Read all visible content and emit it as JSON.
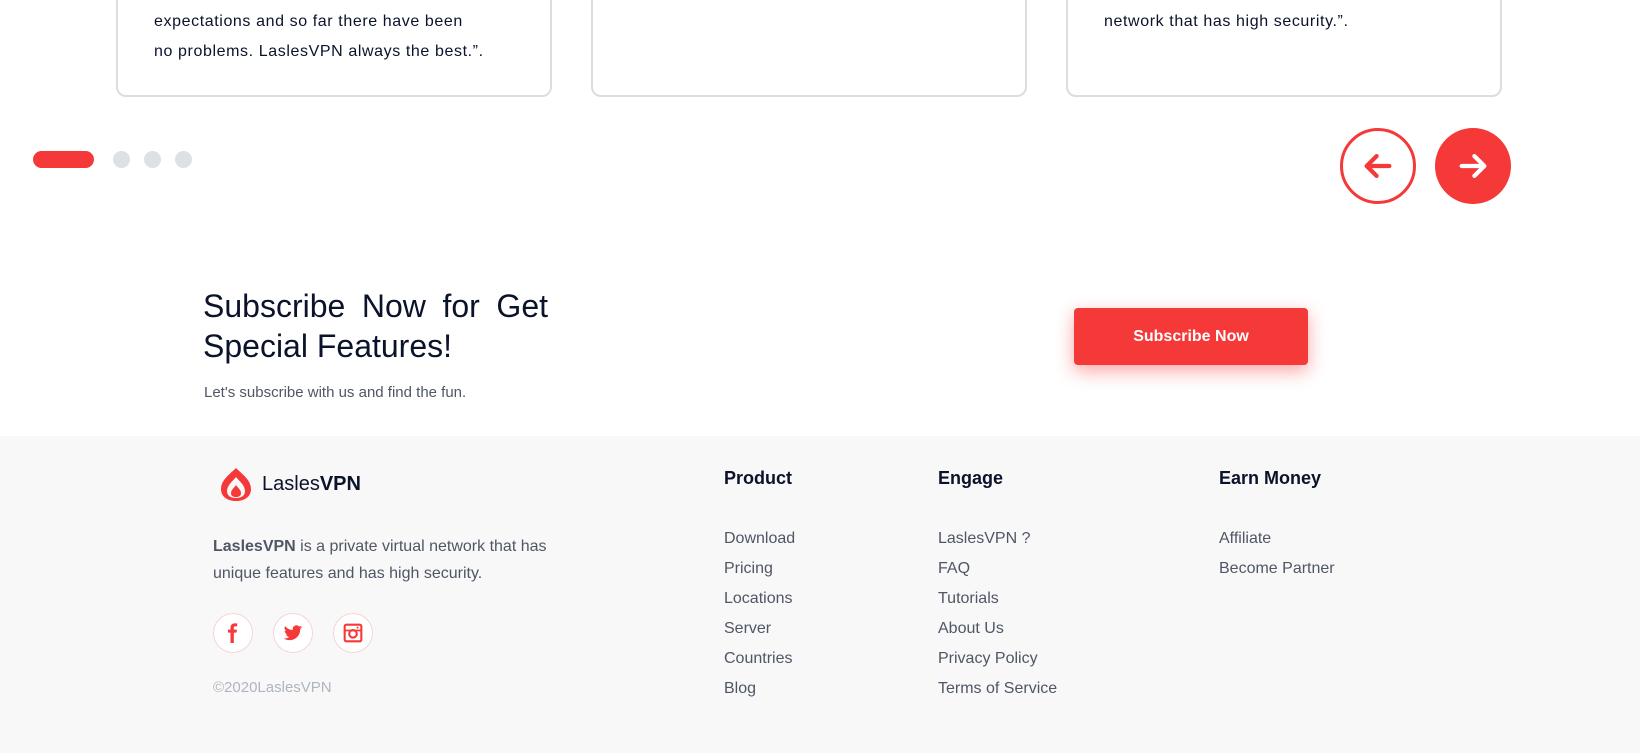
{
  "testimonials": [
    {
      "text_lines": [
        "expectations and so far there have been",
        "no problems. LaslesVPN always the best.”."
      ]
    },
    {
      "text_lines": [
        ""
      ]
    },
    {
      "text_lines": [
        "network that has high security.”."
      ]
    }
  ],
  "slider": {
    "active_index": 0,
    "total": 4
  },
  "subscribe": {
    "title": "Subscribe Now for Get Special Features!",
    "description": "Let's subscribe with us and find the fun.",
    "button_label": "Subscribe Now"
  },
  "footer": {
    "brand_light": "Lasles",
    "brand_bold": "VPN",
    "about_brand": "LaslesVPN",
    "about_text": " is a private virtual network that has unique features and has high security.",
    "copyright": "©2020LaslesVPN",
    "social": [
      "facebook-icon",
      "twitter-icon",
      "instagram-icon"
    ],
    "columns": [
      {
        "title": "Product",
        "links": [
          "Download",
          "Pricing",
          "Locations",
          "Server",
          "Countries",
          "Blog"
        ]
      },
      {
        "title": "Engage",
        "links": [
          "LaslesVPN ?",
          "FAQ",
          "Tutorials",
          "About Us",
          "Privacy Policy",
          "Terms of Service"
        ]
      },
      {
        "title": "Earn Money",
        "links": [
          "Affiliate",
          "Become Partner"
        ]
      }
    ]
  },
  "colors": {
    "accent": "#f53838",
    "text_dark": "#0b132a",
    "text_muted": "#4f5665",
    "footer_bg": "#f8f8f8"
  }
}
